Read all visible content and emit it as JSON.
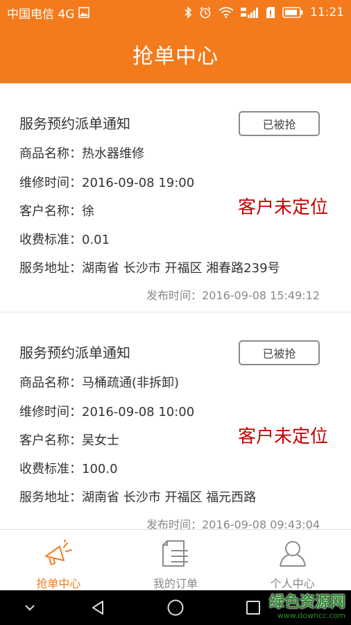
{
  "status_bar": {
    "carrier": "中国电信 4G",
    "time": "11:21",
    "colors": {
      "bg": "#f37b1d",
      "fg": "#ffffff"
    }
  },
  "header": {
    "title": "抢单中心"
  },
  "orders": [
    {
      "title": "服务预约派单通知",
      "button_label": "已被抢",
      "product_label": "商品名称：",
      "product": "热水器维修",
      "time_label": "维修时间：",
      "time": "2016-09-08 19:00",
      "customer_label": "客户名称：",
      "customer": "徐",
      "fee_label": "收费标准：",
      "fee": "0.01",
      "address_label": "服务地址：",
      "address": "湖南省 长沙市 开福区 湘春路239号",
      "location_status": "客户未定位",
      "publish_label": "发布时间：",
      "publish_time": "2016-09-08 15:49:12"
    },
    {
      "title": "服务预约派单通知",
      "button_label": "已被抢",
      "product_label": "商品名称：",
      "product": "马桶疏通(非拆卸)",
      "time_label": "维修时间：",
      "time": "2016-09-08 10:00",
      "customer_label": "客户名称：",
      "customer": "吴女士",
      "fee_label": "收费标准：",
      "fee": "100.0",
      "address_label": "服务地址：",
      "address": "湖南省 长沙市 开福区 福元西路",
      "location_status": "客户未定位",
      "publish_label": "发布时间：",
      "publish_time": "2016-09-08 09:43:04"
    }
  ],
  "tabs": [
    {
      "label": "抢单中心",
      "icon": "megaphone-icon",
      "active": true
    },
    {
      "label": "我的订单",
      "icon": "document-list-icon",
      "active": false
    },
    {
      "label": "个人中心",
      "icon": "user-icon",
      "active": false
    }
  ],
  "watermark": {
    "text": "绿色资源网",
    "url": "www.downcc.com"
  },
  "colors": {
    "accent": "#f37b1d",
    "alert": "#c40000"
  }
}
